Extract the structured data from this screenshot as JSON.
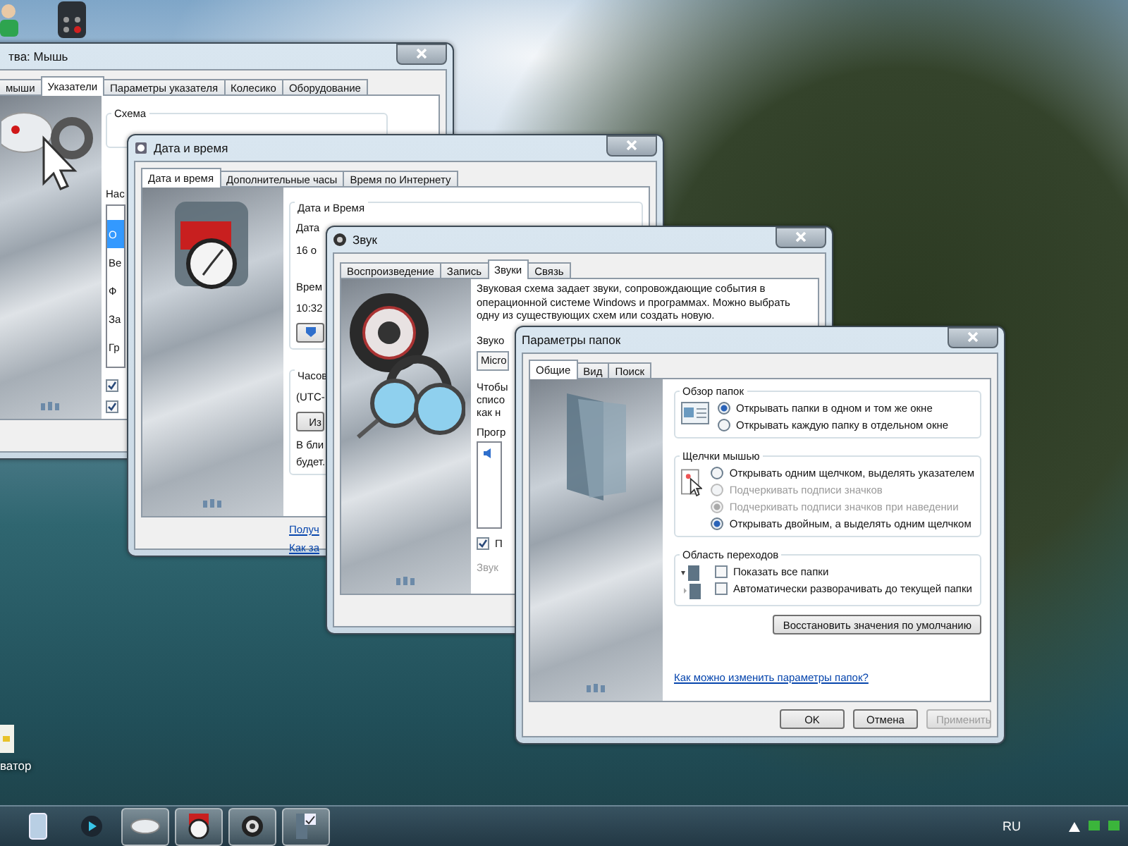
{
  "desktop": {
    "icon_label": "ватор"
  },
  "mouse_window": {
    "title": "тва: Мышь",
    "tabs": [
      {
        "label": "мыши",
        "selected": false
      },
      {
        "label": "Указатели",
        "selected": true
      },
      {
        "label": "Параметры указателя",
        "selected": false
      },
      {
        "label": "Колесико",
        "selected": false
      },
      {
        "label": "Оборудование",
        "selected": false
      }
    ],
    "scheme_label": "Схема",
    "settings_label": "Нас",
    "list": [
      {
        "text": "О",
        "selected": true
      },
      {
        "text": "Ве",
        "selected": false
      },
      {
        "text": "Ф",
        "selected": false
      },
      {
        "text": "За",
        "selected": false
      },
      {
        "text": "Гр",
        "selected": false
      }
    ],
    "checkboxes": [
      {
        "checked": true
      },
      {
        "checked": true
      }
    ]
  },
  "date_window": {
    "title": "Дата и время",
    "tabs": [
      {
        "label": "Дата и время",
        "selected": true
      },
      {
        "label": "Дополнительные часы",
        "selected": false
      },
      {
        "label": "Время по Интернету",
        "selected": false
      }
    ],
    "group_title": "Дата и Время",
    "date_label": "Дата",
    "date_value": "16 о",
    "time_label": "Врем",
    "time_value": "10:32",
    "timezone_label": "Часов",
    "timezone_value": "(UTC-",
    "timezone_button": "Из",
    "note_lines": [
      "В бли",
      "будет."
    ],
    "links": [
      "Получ",
      "Как за"
    ]
  },
  "sound_window": {
    "title": "Звук",
    "tabs": [
      {
        "label": "Воспроизведение",
        "selected": false
      },
      {
        "label": "Запись",
        "selected": false
      },
      {
        "label": "Звуки",
        "selected": true
      },
      {
        "label": "Связь",
        "selected": false
      }
    ],
    "description": "Звуковая схема задает звуки, сопровождающие события в операционной системе Windows и программах. Можно выбрать одну из существующих схем или создать новую.",
    "scheme_label": "Звуко",
    "scheme_value": "Micro",
    "hint_lines": [
      "Чтобы",
      "списо",
      "как н"
    ],
    "events_label": "Прогр",
    "play_checkbox": {
      "label": "П",
      "checked": true
    },
    "sound_label": "Звук"
  },
  "folder_window": {
    "title": "Параметры папок",
    "tabs": [
      {
        "label": "Общие",
        "selected": true
      },
      {
        "label": "Вид",
        "selected": false
      },
      {
        "label": "Поиск",
        "selected": false
      }
    ],
    "groups": [
      {
        "title": "Обзор папок",
        "kind": "radio",
        "options": [
          {
            "label": "Открывать папки в одном и том же окне",
            "selected": true,
            "disabled": false
          },
          {
            "label": "Открывать каждую папку в отдельном окне",
            "selected": false,
            "disabled": false
          }
        ]
      },
      {
        "title": "Щелчки мышью",
        "kind": "radio",
        "options": [
          {
            "label": "Открывать одним щелчком, выделять указателем",
            "selected": false,
            "disabled": false
          },
          {
            "label": "Подчеркивать подписи значков",
            "selected": false,
            "disabled": true
          },
          {
            "label": "Подчеркивать подписи значков при наведении",
            "selected": true,
            "disabled": true
          },
          {
            "label": "Открывать двойным, а выделять одним щелчком",
            "selected": true,
            "disabled": false
          }
        ]
      },
      {
        "title": "Область переходов",
        "kind": "checkbox",
        "options": [
          {
            "label": "Показать все папки",
            "checked": false
          },
          {
            "label": "Автоматически разворачивать до текущей папки",
            "checked": false
          }
        ]
      }
    ],
    "restore_button": "Восстановить значения по умолчанию",
    "help_link": "Как можно изменить параметры папок?",
    "buttons": [
      {
        "label": "OK",
        "disabled": false
      },
      {
        "label": "Отмена",
        "disabled": false
      },
      {
        "label": "Применить",
        "disabled": true
      }
    ]
  },
  "taskbar": {
    "items": [
      {
        "kind": "explorer",
        "active": false
      },
      {
        "kind": "media",
        "active": false
      },
      {
        "kind": "mouse",
        "active": true
      },
      {
        "kind": "clock",
        "active": true
      },
      {
        "kind": "speaker",
        "active": true
      },
      {
        "kind": "panel",
        "active": true
      }
    ],
    "language": "RU"
  }
}
